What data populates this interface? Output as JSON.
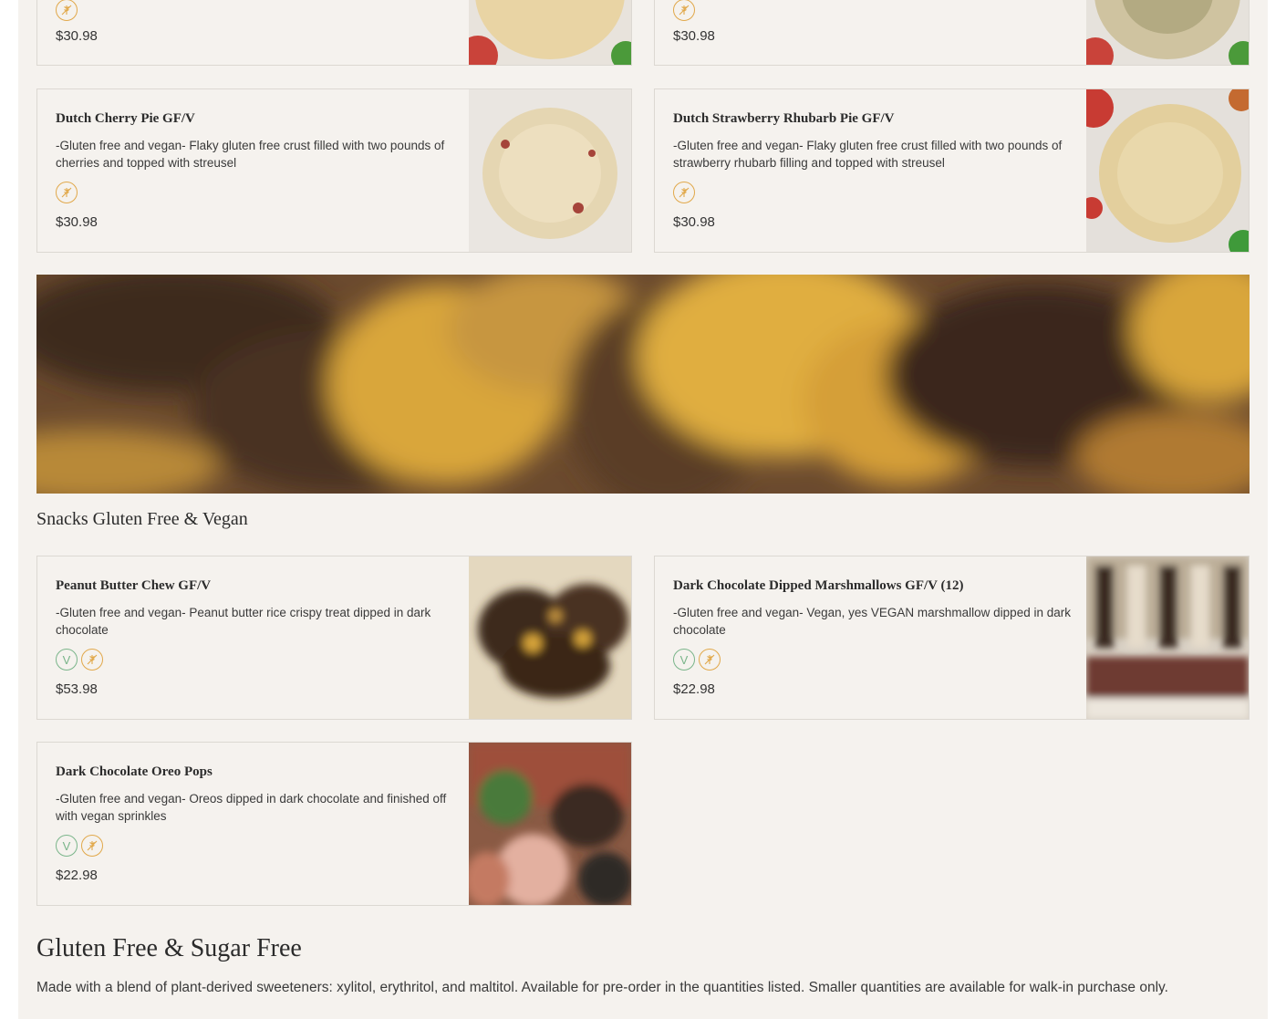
{
  "top_cards": [
    {
      "price": "$30.98"
    },
    {
      "price": "$30.98"
    }
  ],
  "pie_cards": [
    {
      "name": "Dutch Cherry Pie GF/V",
      "desc": "-Gluten free and vegan- Flaky gluten free crust filled with two pounds of cherries and topped with streusel",
      "price": "$30.98"
    },
    {
      "name": "Dutch Strawberry Rhubarb Pie GF/V",
      "desc": "-Gluten free and vegan- Flaky gluten free crust filled with two pounds of strawberry rhubarb filling and topped with streusel",
      "price": "$30.98"
    }
  ],
  "snacks_section": {
    "title": "Snacks Gluten Free & Vegan"
  },
  "snack_cards": [
    {
      "name": "Peanut Butter Chew GF/V",
      "desc": "-Gluten free and vegan- Peanut butter rice crispy treat dipped in dark chocolate",
      "price": "$53.98"
    },
    {
      "name": "Dark Chocolate Dipped Marshmallows GF/V (12)",
      "desc": "-Gluten free and vegan- Vegan, yes VEGAN marshmallow dipped in dark chocolate",
      "price": "$22.98"
    },
    {
      "name": "Dark Chocolate Oreo Pops",
      "desc": "-Gluten free and vegan- Oreos dipped in dark chocolate and finished off with vegan sprinkles",
      "price": "$22.98"
    }
  ],
  "badges": {
    "vegan": "V",
    "gluten_free_icon": "wheat-crossed-icon",
    "gf_color": "#e1a84a",
    "vegan_color": "#7ab58a"
  },
  "gf_sf_section": {
    "title": "Gluten Free & Sugar Free",
    "description": "Made with a blend of plant-derived sweeteners: xylitol, erythritol, and maltitol. Available for pre-order in the quantities listed. Smaller quantities are available for walk-in purchase only."
  }
}
